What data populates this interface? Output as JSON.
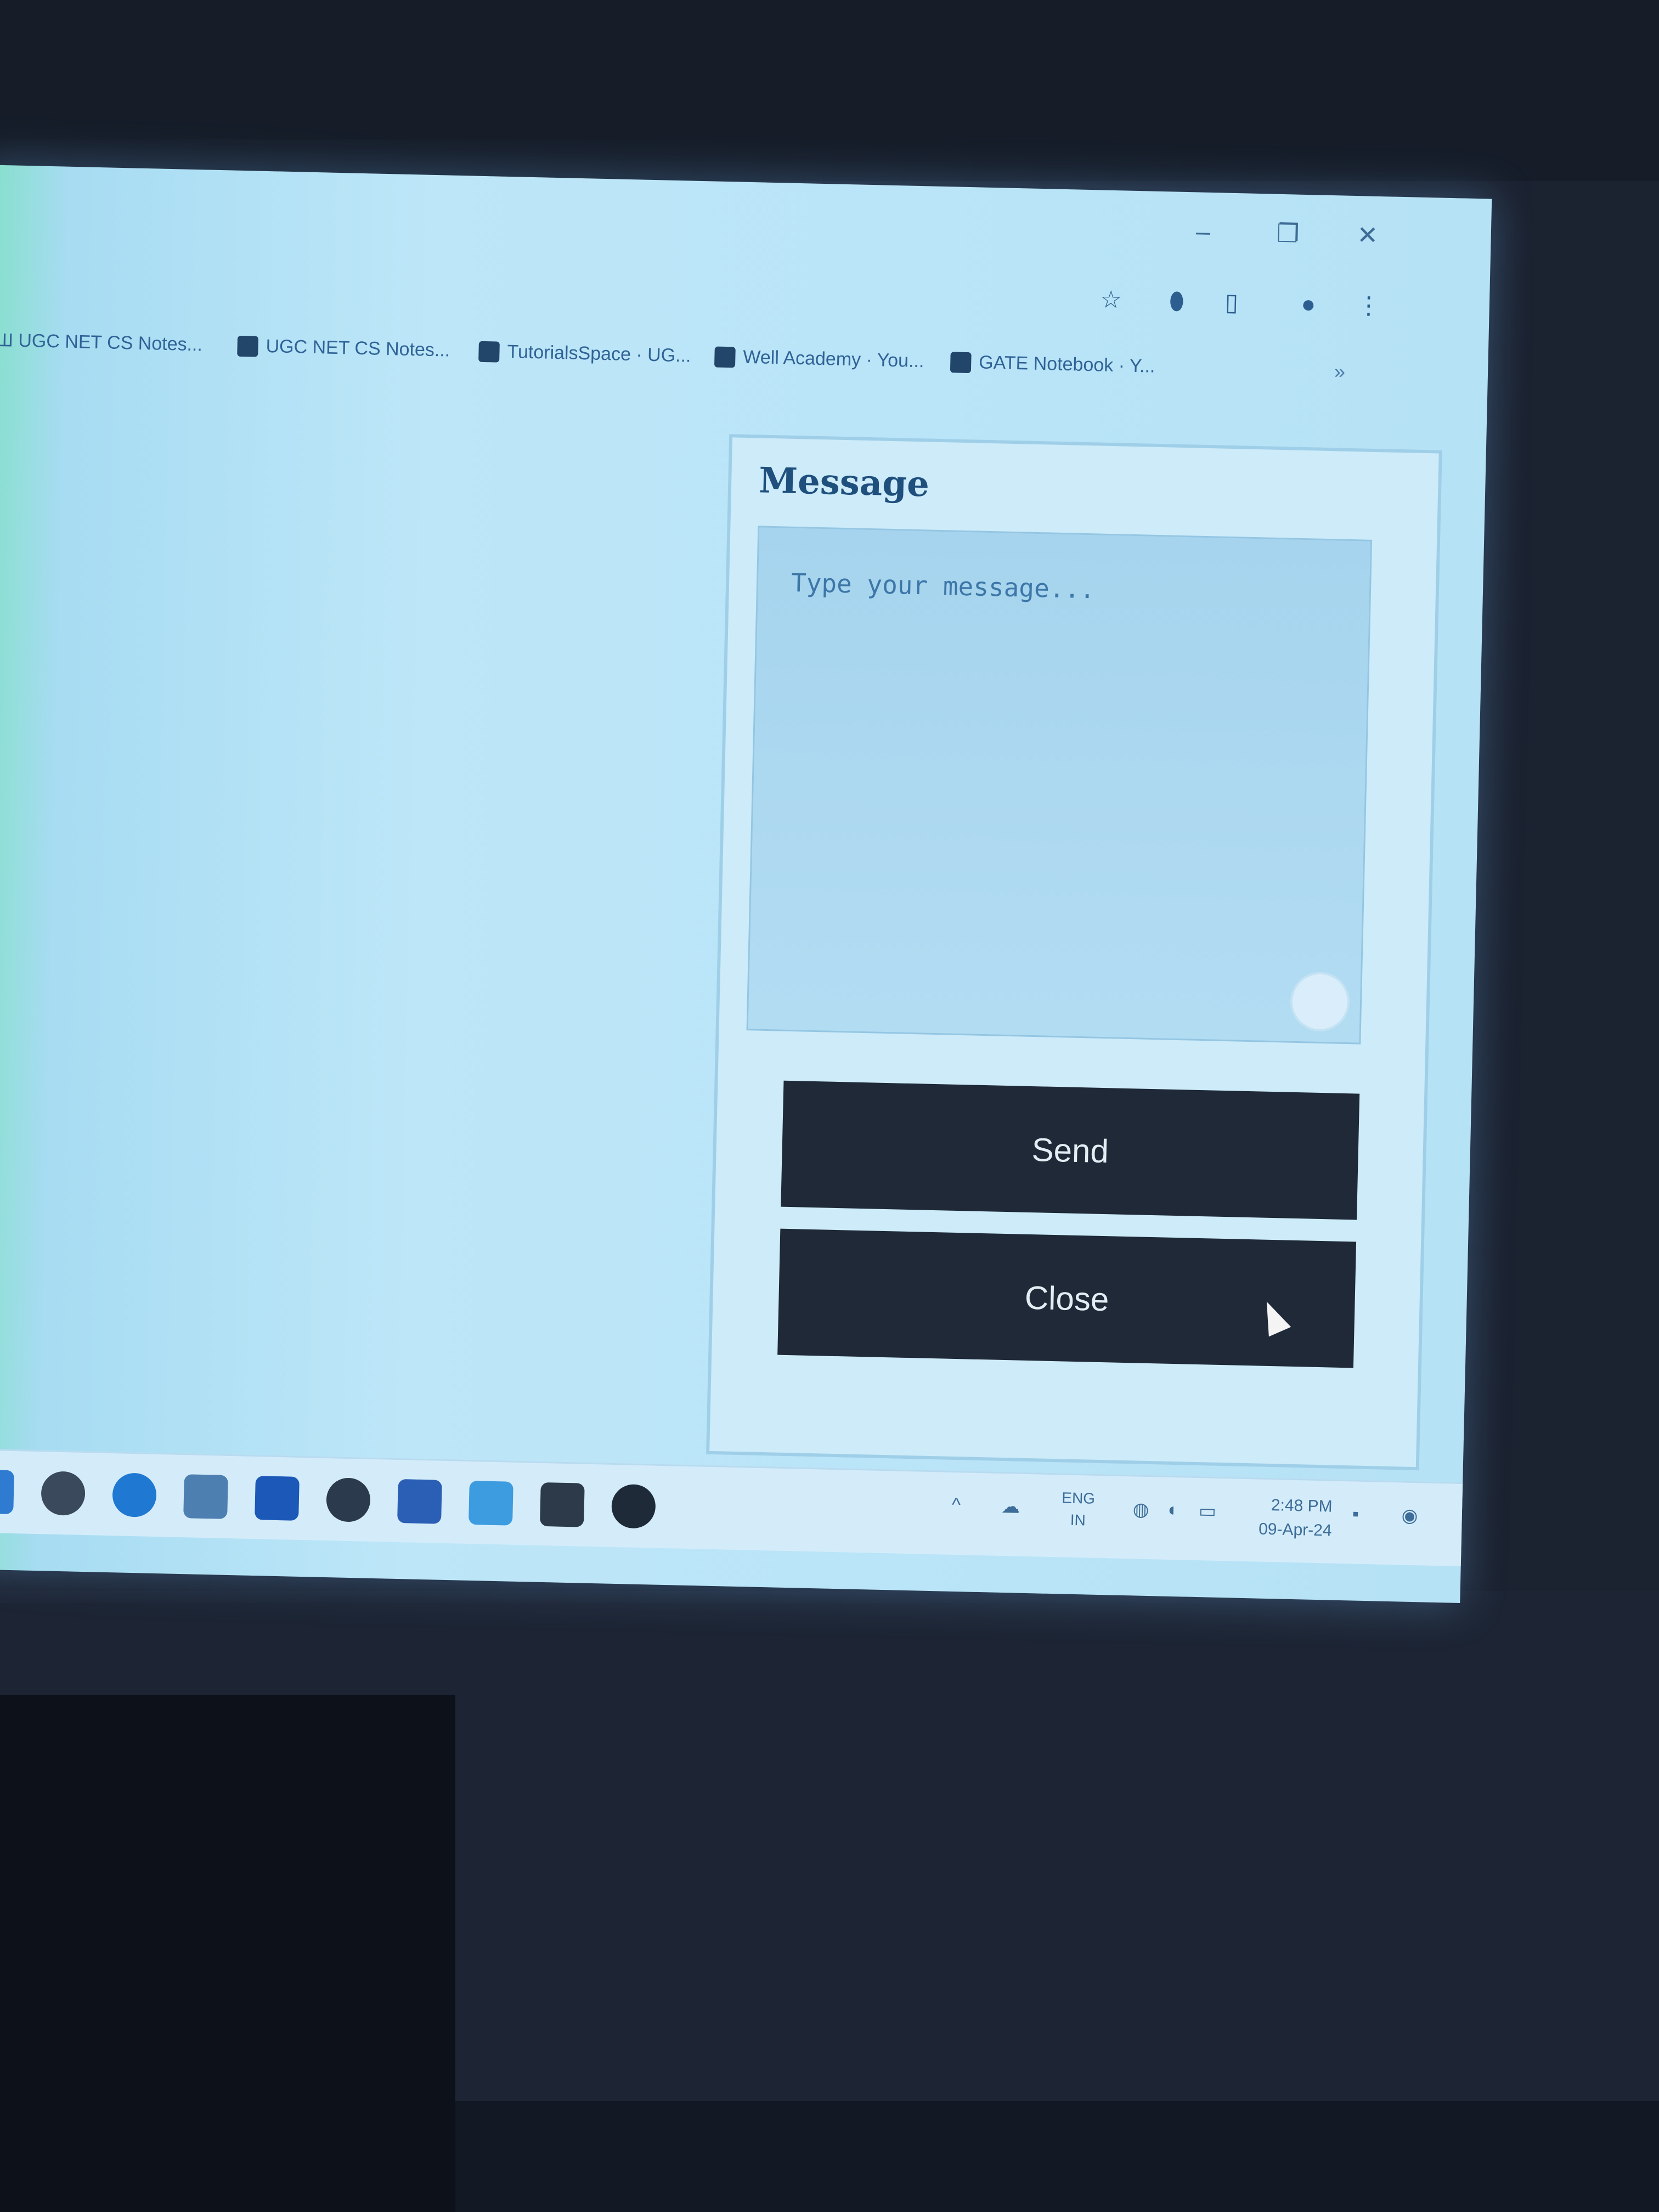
{
  "window": {
    "controls": {
      "minimize": "–",
      "maximize": "❐",
      "close": "✕"
    }
  },
  "toolbar": {
    "icons": [
      "star-icon",
      "extension-icon",
      "sidepanel-icon",
      "profile-icon",
      "menu-icon"
    ]
  },
  "bookmarks": [
    "Ш UGC NET CS Notes...",
    "UGC NET CS Notes...",
    "TutorialsSpace · UG...",
    "Well Academy · You...",
    "GATE Notebook · Y..."
  ],
  "bookmarks_more": "»",
  "message_panel": {
    "title": "Message",
    "placeholder": "Type your message...",
    "send_label": "Send",
    "close_label": "Close"
  },
  "taskbar": {
    "apps": [
      "file-explorer-icon",
      "chrome-icon",
      "edge-icon",
      "notepad-icon",
      "store-icon",
      "app-icon",
      "vs-icon",
      "vscode-icon",
      "app2-icon",
      "obs-icon"
    ],
    "tray": {
      "chevron": "^",
      "language_top": "ENG",
      "language_bottom": "IN",
      "time": "2:48 PM",
      "date": "09-Apr-24"
    }
  },
  "colors": {
    "accent_dark": "#1f2937",
    "screen_bg": "#bde6f8",
    "text_blue": "#1f4f7d"
  }
}
